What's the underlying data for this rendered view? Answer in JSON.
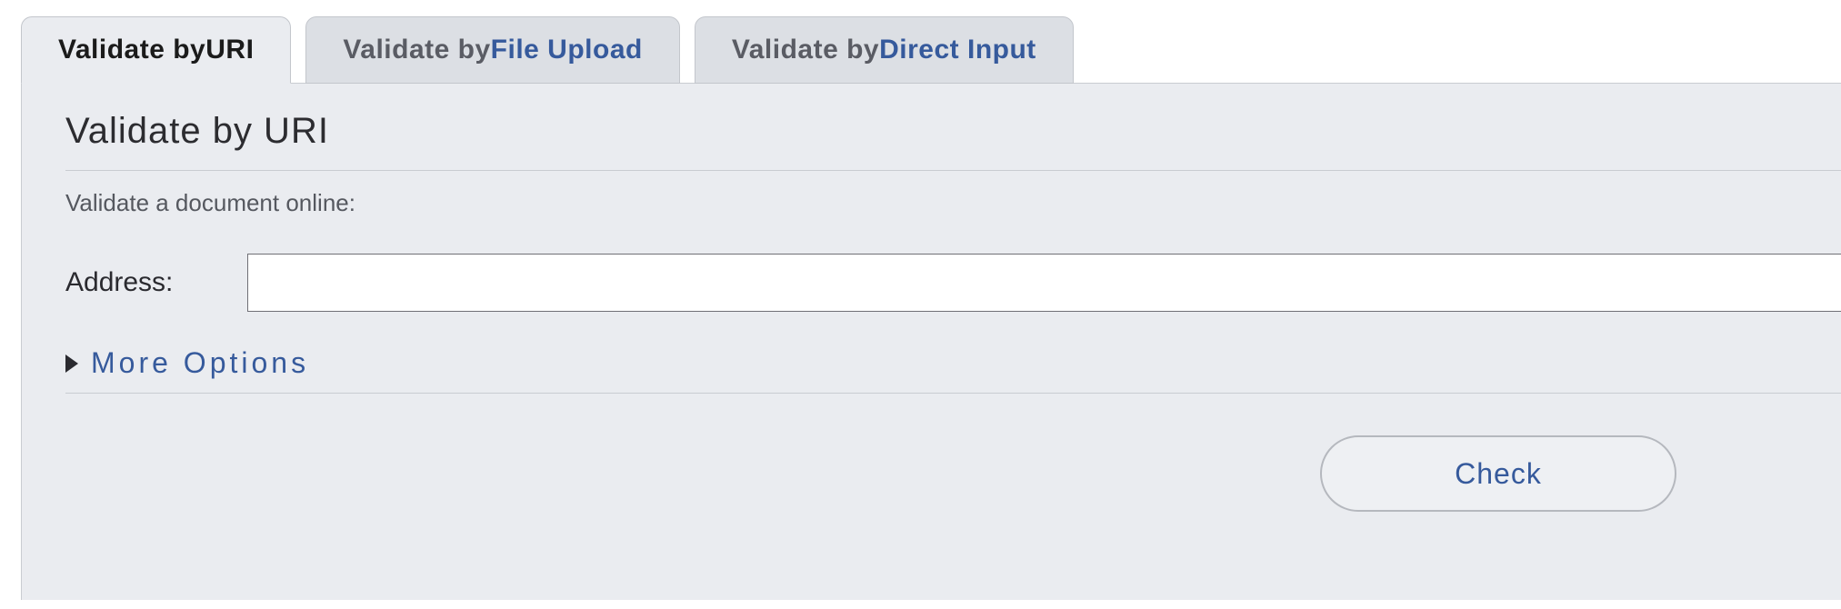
{
  "tabs": [
    {
      "prefix": "Validate by ",
      "accent": "URI",
      "active": true
    },
    {
      "prefix": "Validate by ",
      "accent": "File Upload",
      "active": false
    },
    {
      "prefix": "Validate by ",
      "accent": "Direct Input",
      "active": false
    }
  ],
  "panel": {
    "heading": "Validate by URI",
    "subtitle": "Validate a document online:",
    "address_label": "Address:",
    "address_value": "",
    "more_options_label": "More Options",
    "check_label": "Check"
  }
}
